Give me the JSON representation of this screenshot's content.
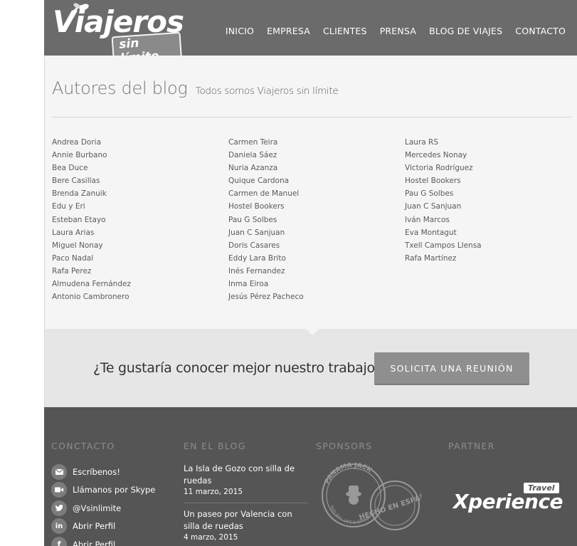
{
  "header": {
    "logo_text": "Viajeros",
    "logo_badge": "sin límite",
    "nav": [
      "INICIO",
      "EMPRESA",
      "CLIENTES",
      "PRENSA",
      "BLOG DE VIAJES",
      "CONTACTO"
    ]
  },
  "main": {
    "title": "Autores del blog",
    "subtitle": "Todos somos Viajeros sin límite",
    "authors": {
      "col1": [
        "Andrea Doria",
        "Annie Burbano",
        "Bea Duce",
        "Bere Casillas",
        "Brenda Zanuik",
        "Edu y Eri",
        "Esteban Etayo",
        "Laura Arias",
        "Miguel Nonay",
        "Paco Nadal",
        "Rafa Perez",
        "Almudena Fernández",
        "Antonio Cambronero"
      ],
      "col2": [
        "Carmen Teira",
        "Daniela Sáez",
        "Nuria Azanza",
        "Quique Cardona",
        "Carmen de Manuel",
        "Hostel Bookers",
        "Pau G Solbes",
        "Juan C Sanjuan",
        "Doris Casares",
        "Eddy Lara Brito",
        "Inés Fernandez",
        "Inma Eiroa",
        "Jesús Pérez Pacheco"
      ],
      "col3": [
        "Laura RS",
        "Mercedes Nonay",
        "Victoria Rodríguez",
        "Hostel Bookers",
        "Pau G Solbes",
        "Juan C Sanjuan",
        "Iván Marcos",
        "Eva Montagut",
        "Txell Campos Llensa",
        "Rafa Martínez"
      ]
    }
  },
  "cta": {
    "question": "¿Te gustaría conocer mejor nuestro trabajo?",
    "button": "SOLICITA UNA REUNIÓN"
  },
  "footer": {
    "headings": [
      "CONCTACTO",
      "EN EL BLOG",
      "SPONSORS",
      "PARTNER"
    ],
    "contact": [
      {
        "icon": "mail-icon",
        "label": "Escríbenos!"
      },
      {
        "icon": "video-icon",
        "label": "Llámanos por Skype"
      },
      {
        "icon": "twitter-icon",
        "label": "@Vsinlimite"
      },
      {
        "icon": "linkedin-icon",
        "label": "Abrir Perfil"
      },
      {
        "icon": "facebook-icon",
        "label": "Abrir Perfil"
      }
    ],
    "posts": [
      {
        "title": "La Isla de Gozo con silla de ruedas",
        "date": "11 marzo, 2015"
      },
      {
        "title": "Un paseo por Valencia con silla de ruedas",
        "date": "4 marzo, 2015"
      }
    ],
    "sponsor_logo": {
      "stamp1": "PANAMA JACK",
      "stamp1_sub": "NATURAL LIFE & STYLE",
      "stamp2": "HECHO EN ESPAÑA"
    },
    "partner_logo": {
      "main": "Xperience",
      "tag": "Travel"
    }
  },
  "colors": {
    "header_bg": "#6b6b6b",
    "footer_bg": "#555555",
    "cta_btn": "#8f8f8f"
  }
}
